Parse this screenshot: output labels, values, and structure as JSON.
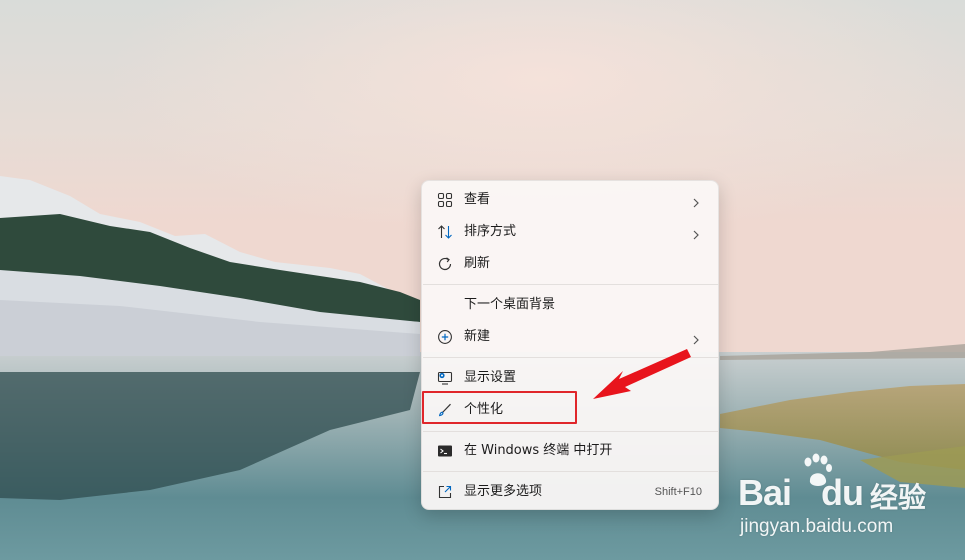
{
  "context_menu": {
    "items": [
      {
        "label": "查看",
        "icon": "view-grid-icon",
        "has_submenu": true
      },
      {
        "label": "排序方式",
        "icon": "sort-icon",
        "has_submenu": true
      },
      {
        "label": "刷新",
        "icon": "refresh-icon",
        "has_submenu": false
      },
      {
        "label": "下一个桌面背景",
        "icon": "",
        "has_submenu": false
      },
      {
        "label": "新建",
        "icon": "new-plus-icon",
        "has_submenu": true
      },
      {
        "label": "显示设置",
        "icon": "display-settings-icon",
        "has_submenu": false
      },
      {
        "label": "个性化",
        "icon": "personalize-brush-icon",
        "has_submenu": false
      },
      {
        "label": "在 Windows 终端 中打开",
        "icon": "terminal-icon",
        "has_submenu": false
      },
      {
        "label": "显示更多选项",
        "icon": "show-more-options-icon",
        "has_submenu": false,
        "shortcut": "Shift+F10"
      }
    ]
  },
  "annotation": {
    "highlighted_item": "个性化",
    "highlight_color": "#e0262a",
    "arrow_color": "#e8141c"
  },
  "watermark": {
    "brand": "Bai",
    "brand_suffix": "du",
    "cn_text": "经验",
    "url": "jingyan.baidu.com"
  },
  "colors": {
    "accent_blue": "#0067c0",
    "menu_bg": "#faf7f6"
  }
}
